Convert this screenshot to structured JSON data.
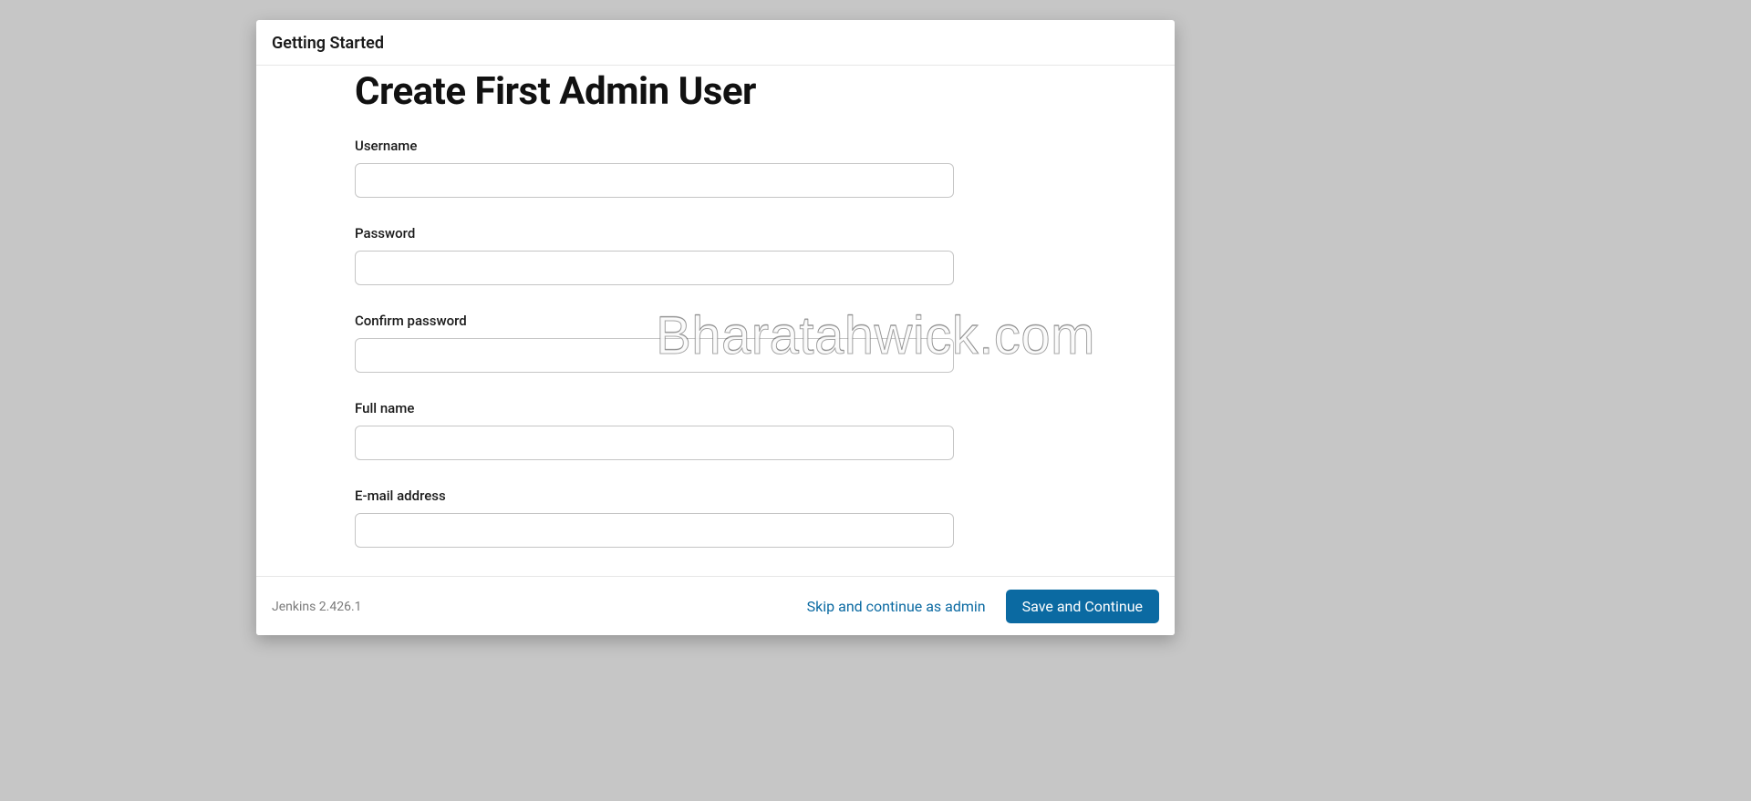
{
  "header": {
    "title": "Getting Started"
  },
  "page": {
    "heading": "Create First Admin User"
  },
  "form": {
    "username": {
      "label": "Username",
      "value": ""
    },
    "password": {
      "label": "Password",
      "value": ""
    },
    "confirm": {
      "label": "Confirm password",
      "value": ""
    },
    "fullname": {
      "label": "Full name",
      "value": ""
    },
    "email": {
      "label": "E-mail address",
      "value": ""
    }
  },
  "footer": {
    "version": "Jenkins 2.426.1",
    "skip_label": "Skip and continue as admin",
    "save_label": "Save and Continue"
  },
  "watermark": "Bharatahwick.com"
}
